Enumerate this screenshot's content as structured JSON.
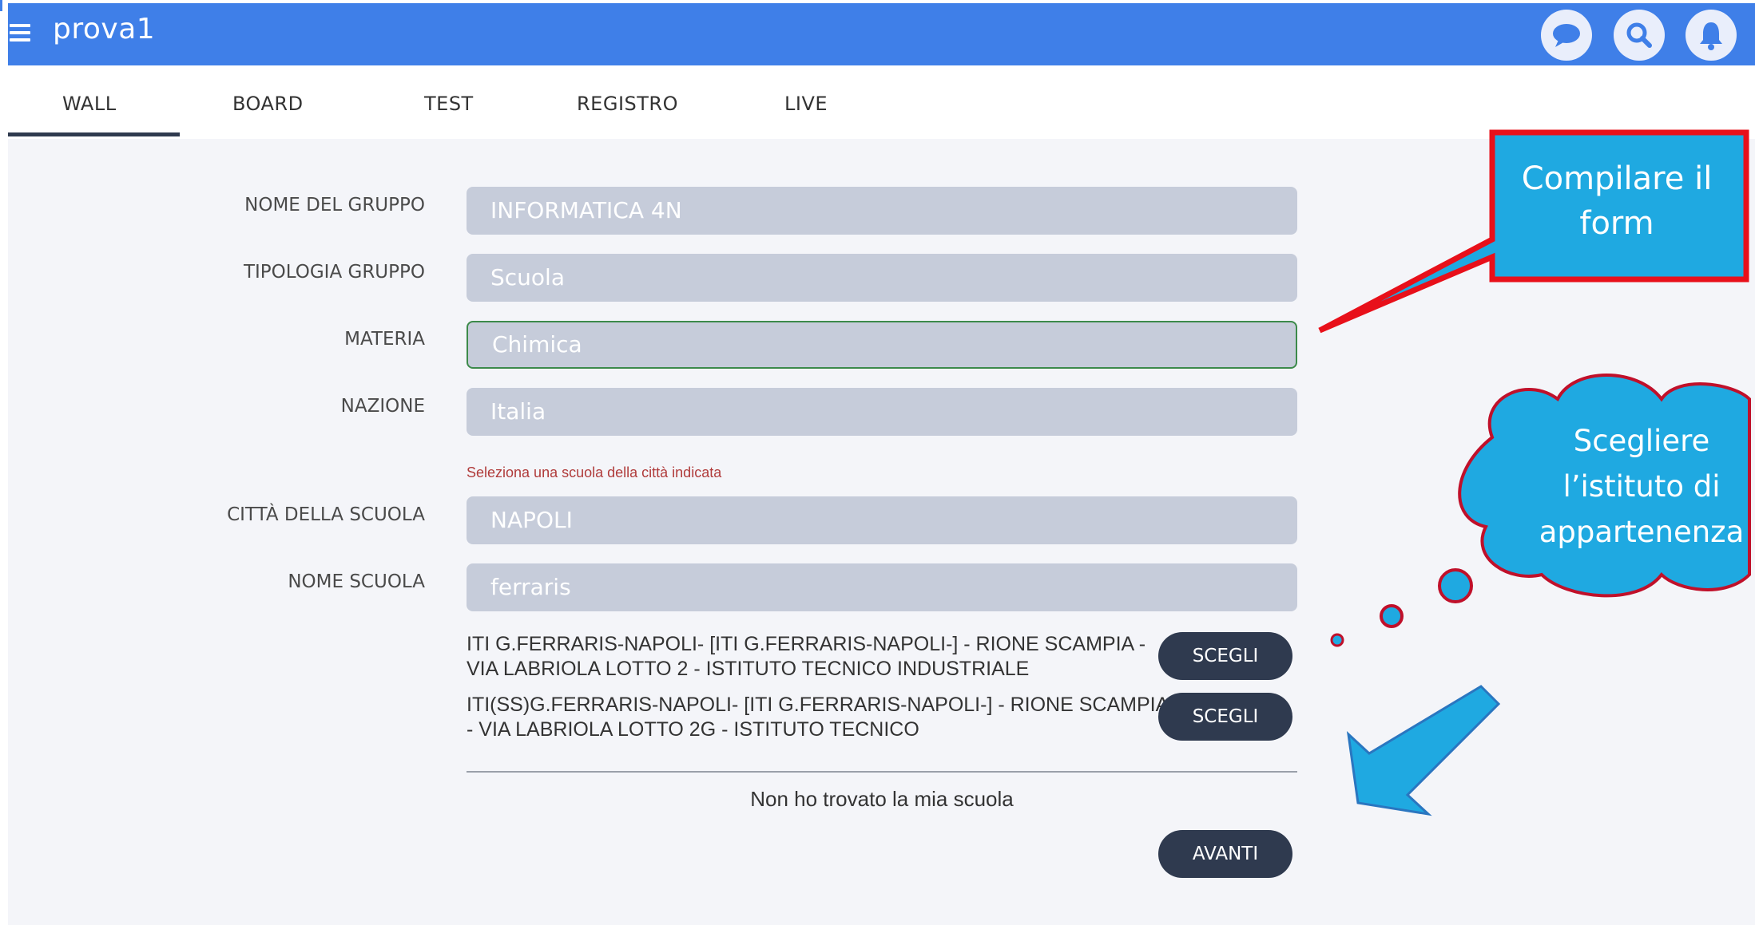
{
  "header": {
    "title": "prova1",
    "menu_icon": "hamburger-menu-icon",
    "icons": [
      "chat-icon",
      "search-icon",
      "bell-icon"
    ],
    "color": "#3f7fe8"
  },
  "tabs": [
    {
      "label": "WALL",
      "active": true
    },
    {
      "label": "BOARD"
    },
    {
      "label": "TEST"
    },
    {
      "label": "REGISTRO"
    },
    {
      "label": "LIVE"
    }
  ],
  "form": {
    "group_name": {
      "label": "NOME DEL GRUPPO",
      "value": "INFORMATICA 4N"
    },
    "group_type": {
      "label": "TIPOLOGIA GRUPPO",
      "value": "Scuola"
    },
    "subject": {
      "label": "MATERIA",
      "value": "Chimica"
    },
    "country": {
      "label": "NAZIONE",
      "value": "Italia"
    },
    "hint": "Seleziona una scuola della città indicata",
    "city": {
      "label": "CITTÀ DELLA SCUOLA",
      "value": "NAPOLI"
    },
    "school_name": {
      "label": "NOME SCUOLA",
      "value": "ferraris"
    }
  },
  "results": [
    {
      "text": "ITI G.FERRARIS-NAPOLI- [ITI G.FERRARIS-NAPOLI-] - RIONE SCAMPIA - VIA LABRIOLA LOTTO 2 - ISTITUTO TECNICO INDUSTRIALE",
      "button": "SCEGLI"
    },
    {
      "text": "ITI(SS)G.FERRARIS-NAPOLI- [ITI G.FERRARIS-NAPOLI-] - RIONE SCAMPIA - VIA LABRIOLA LOTTO 2G - ISTITUTO TECNICO",
      "button": "SCEGLI"
    }
  ],
  "not_found": "Non ho trovato la mia scuola",
  "next_button": "AVANTI",
  "annotations": {
    "callout": "Compilare il form",
    "cloud": "Scegliere l’istituto di appartenenza",
    "callout_color": "#1fa9e1",
    "callout_border": "#e8101a"
  }
}
